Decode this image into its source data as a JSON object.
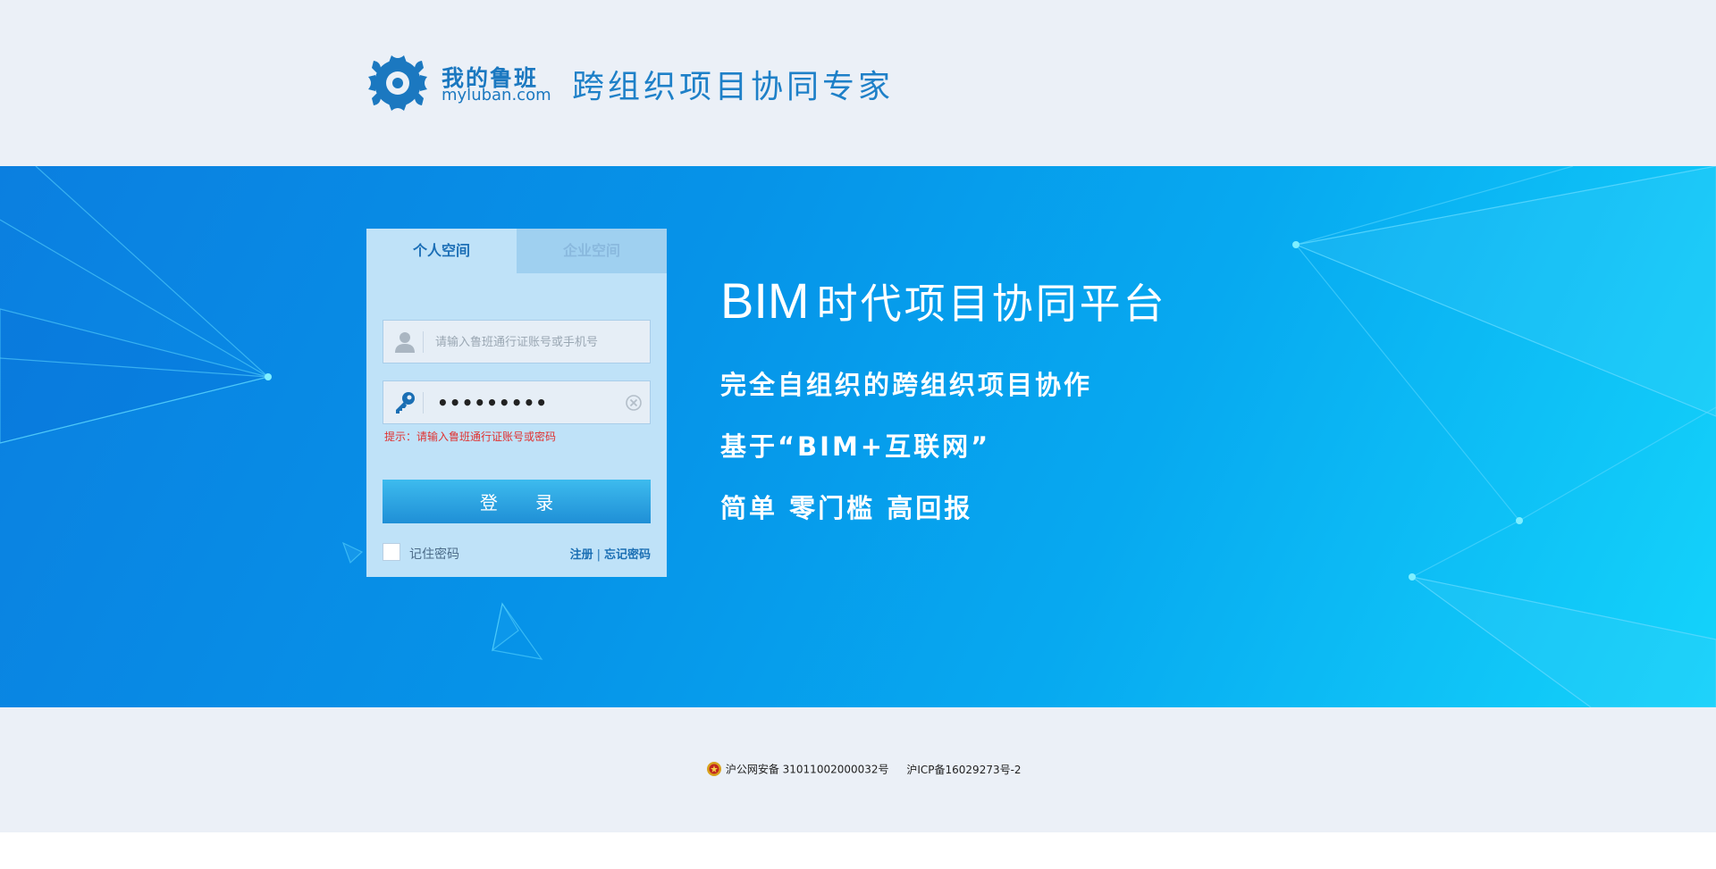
{
  "header": {
    "logo_name": "我的鲁班",
    "logo_domain": "myluban.com",
    "slogan": "跨组织项目协同专家"
  },
  "login": {
    "tabs": [
      {
        "label": "个人空间",
        "active": true
      },
      {
        "label": "企业空间",
        "active": false
      }
    ],
    "username_placeholder": "请输入鲁班通行证账号或手机号",
    "username_value": "",
    "password_display": "•••••••••",
    "hint": "提示：请输入鲁班通行证账号或密码",
    "login_button": "登 录",
    "remember_label": "记住密码",
    "register_link": "注册",
    "separator": "|",
    "forgot_link": "忘记密码"
  },
  "promo": {
    "headline_bim": "BIM",
    "headline_rest": "时代项目协同平台",
    "features": [
      "完全自组织的跨组织项目协作",
      "基于“BIM+互联网”",
      "简单 零门槛 高回报"
    ]
  },
  "footer": {
    "police_record": "沪公网安备 31011002000032号",
    "icp": "沪ICP备16029273号-2"
  },
  "colors": {
    "brand": "#1b78c0",
    "banner_start": "#0b7fe0",
    "banner_end": "#14d4fb",
    "hint_red": "#e0312f",
    "page_bg": "#ebf0f7"
  },
  "icons": {
    "logo": "gear-logo-icon",
    "user": "user-icon",
    "password": "key-icon",
    "clear": "clear-icon",
    "police_badge": "police-badge-icon"
  }
}
